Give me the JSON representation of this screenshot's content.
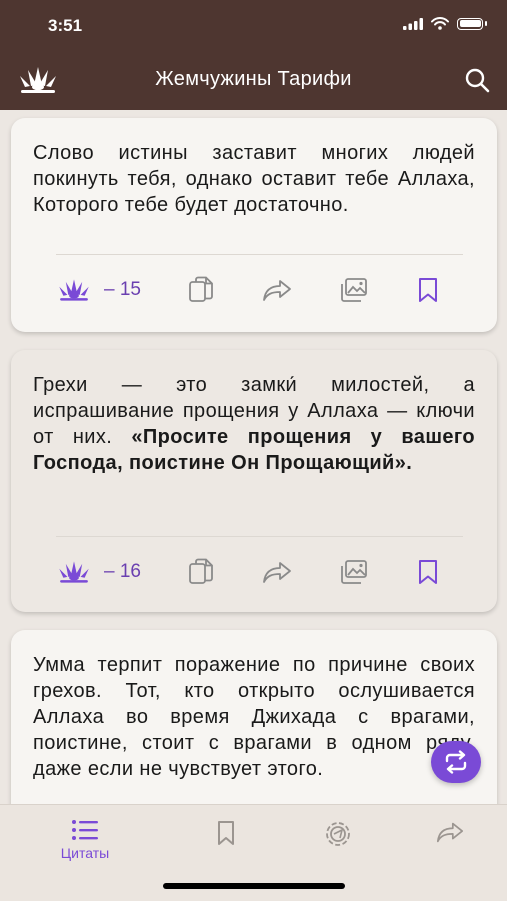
{
  "status_bar": {
    "time": "3:51"
  },
  "header": {
    "title": "Жемчужины Тарифи"
  },
  "quotes": [
    {
      "parts": [
        {
          "text": "Слово истины заставит многих людей покинуть тебя, однако оставит тебе Аллаха, Которого тебе будет достаточно.",
          "bold": false
        }
      ],
      "number": "– 15"
    },
    {
      "parts": [
        {
          "text": "Грехи — это замки́ милостей, а испрашивание прощения у Аллаха — ключи от них. ",
          "bold": false
        },
        {
          "text": "«Просите прощения у вашего Господа, поистине Он Прощающий».",
          "bold": true
        }
      ],
      "number": "– 16"
    },
    {
      "parts": [
        {
          "text": "Умма терпит поражение по причине своих грехов. Тот, кто открыто ослушивается Аллаха во время Джихада с врагами, поистине, стоит с врагами в одном ряду, даже если не чувствует этого.",
          "bold": false
        }
      ],
      "number": ""
    }
  ],
  "tabbar": {
    "tabs": [
      {
        "label": "Цитаты",
        "icon": "list-icon",
        "active": true
      },
      {
        "label": "",
        "icon": "bookmark-icon",
        "active": false
      },
      {
        "label": "",
        "icon": "settings-icon",
        "active": false
      },
      {
        "label": "",
        "icon": "share-icon",
        "active": false
      }
    ]
  },
  "colors": {
    "header": "#4e3630",
    "accent": "#7a4ad6",
    "background": "#ece7e2",
    "card": "#f7f5f2"
  }
}
